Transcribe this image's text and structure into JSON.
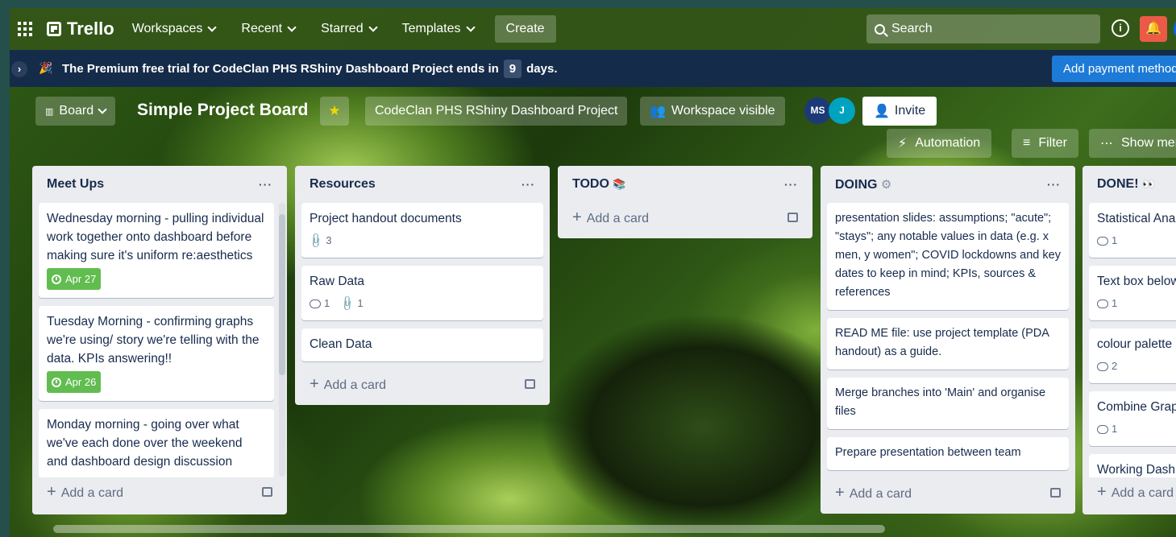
{
  "nav": {
    "logo": "Trello",
    "workspaces": "Workspaces",
    "recent": "Recent",
    "starred": "Starred",
    "templates": "Templates",
    "create": "Create",
    "search": "Search"
  },
  "banner": {
    "text_before": "The Premium free trial for CodeClan PHS RShiny Dashboard Project ends in",
    "days": "9",
    "text_after": "days.",
    "button": "Add payment method"
  },
  "board": {
    "view": "Board",
    "title": "Simple Project Board",
    "workspace": "CodeClan PHS RShiny Dashboard Project",
    "visibility": "Workspace visible",
    "avatar1": "MS",
    "avatar2": "J",
    "invite": "Invite",
    "automation": "Automation",
    "filter": "Filter",
    "show_menu": "Show menu"
  },
  "add_card": "Add a card",
  "lists": [
    {
      "title": "Meet Ups",
      "cards": [
        {
          "text": "Wednesday morning - pulling individual work together onto dashboard before making sure it's uniform re:aesthetics",
          "due": "Apr 27"
        },
        {
          "text": "Tuesday Morning - confirming graphs we're using/ story we're telling with the data. KPIs answering!!",
          "due": "Apr 26"
        },
        {
          "text": "Monday morning - going over what we've each done over the weekend and dashboard design discussion"
        }
      ]
    },
    {
      "title": "Resources",
      "cards": [
        {
          "text": "Project handout documents",
          "attachments": "3"
        },
        {
          "text": "Raw Data",
          "comments": "1",
          "attachments": "1"
        },
        {
          "text": "Clean Data"
        }
      ]
    },
    {
      "title": "TODO",
      "cards": []
    },
    {
      "title": "DOING",
      "cards": [
        {
          "text": "presentation slides: assumptions; \"acute\"; \"stays\"; any notable values in data (e.g. x men, y women\"; COVID lockdowns and key dates to keep in mind; KPIs, sources & references"
        },
        {
          "text": "READ ME file: use project template (PDA handout) as a guide."
        },
        {
          "text": "Merge branches into 'Main' and organise files"
        },
        {
          "text": "Prepare presentation between team"
        }
      ]
    },
    {
      "title": "DONE!",
      "cards": [
        {
          "text": "Statistical Analysis",
          "comments": "1"
        },
        {
          "text": "Text box below",
          "comments": "1"
        },
        {
          "text": "colour palette",
          "comments": "2"
        },
        {
          "text": "Combine Graphs",
          "comments": "1"
        },
        {
          "text": "Working Dashboard"
        }
      ]
    }
  ]
}
